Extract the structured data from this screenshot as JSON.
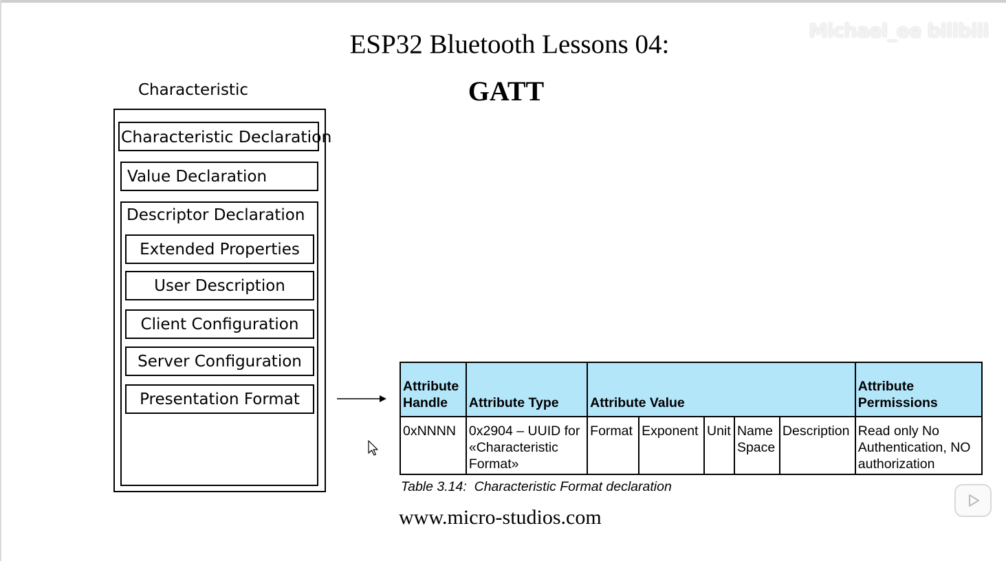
{
  "slide": {
    "title_line1": "ESP32 Bluetooth Lessons 04:",
    "title_line2": "GATT",
    "website": "www.micro-studios.com",
    "watermark": "Michael_ee bilibili"
  },
  "diagram": {
    "label": "Characteristic",
    "characteristic_declaration": "Characteristic Declaration",
    "value_declaration": "Value Declaration",
    "descriptor_declaration": "Descriptor Declaration",
    "descriptors": [
      "Extended Properties",
      "User Description",
      "Client Configuration",
      "Server Configuration",
      "Presentation Format"
    ]
  },
  "table": {
    "headers": [
      "Attribute Handle",
      "Attribute Type",
      "Attribute Value",
      "Attribute Permissions"
    ],
    "row": {
      "handle": "0xNNNN",
      "type": "0x2904 – UUID for «Characteristic Format»",
      "value_fields": [
        "Format",
        "Exponent",
        "Unit",
        "Name Space",
        "Description"
      ],
      "permissions": "Read only No Authentication, NO authorization"
    },
    "caption": "Table 3.14:  Characteristic Format declaration",
    "header_color": "#b4e6f9"
  },
  "icons": [
    "arrow-right-icon",
    "cursor-icon",
    "play-icon"
  ]
}
